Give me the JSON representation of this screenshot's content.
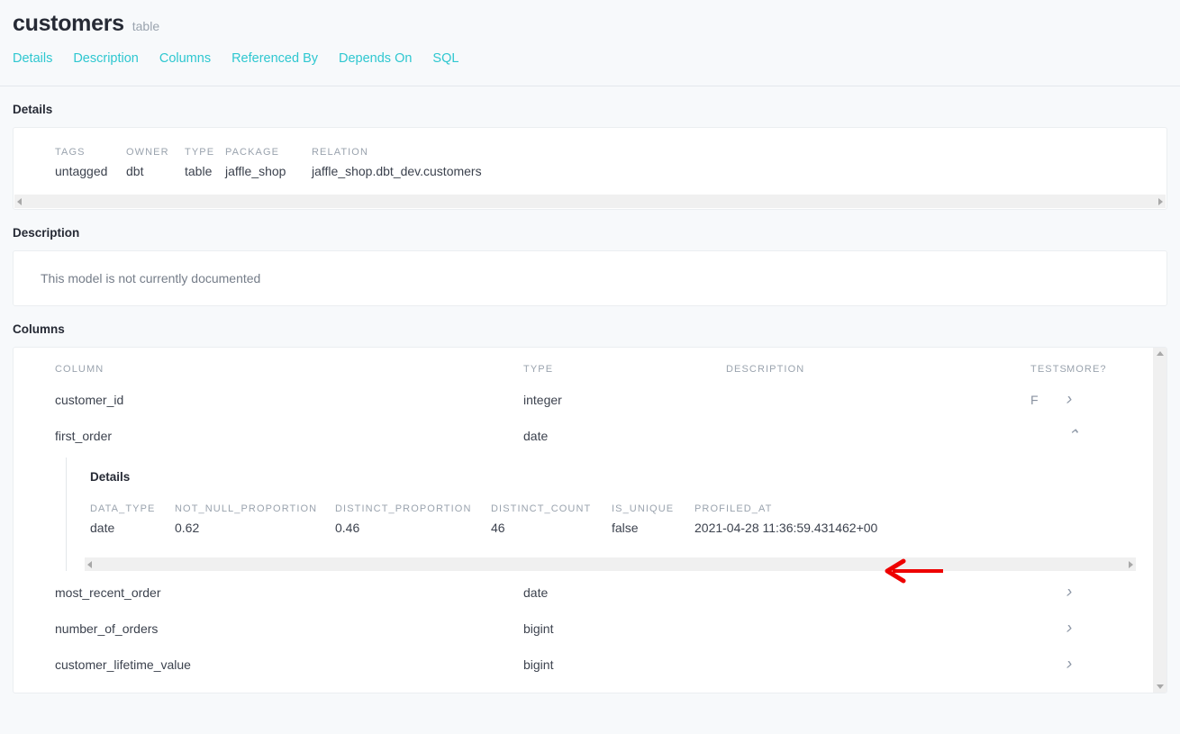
{
  "header": {
    "title": "customers",
    "subtitle": "table",
    "tabs": [
      {
        "label": "Details"
      },
      {
        "label": "Description"
      },
      {
        "label": "Columns"
      },
      {
        "label": "Referenced By"
      },
      {
        "label": "Depends On"
      },
      {
        "label": "SQL"
      }
    ]
  },
  "details": {
    "section_label": "Details",
    "fields": [
      {
        "label": "TAGS",
        "value": "untagged"
      },
      {
        "label": "OWNER",
        "value": "dbt"
      },
      {
        "label": "TYPE",
        "value": "table"
      },
      {
        "label": "PACKAGE",
        "value": "jaffle_shop"
      },
      {
        "label": "RELATION",
        "value": "jaffle_shop.dbt_dev.customers"
      }
    ]
  },
  "description": {
    "section_label": "Description",
    "text": "This model is not currently documented"
  },
  "columns": {
    "section_label": "Columns",
    "headers": {
      "column": "COLUMN",
      "type": "TYPE",
      "description": "DESCRIPTION",
      "tests": "TESTS",
      "more": "MORE?"
    },
    "rows": [
      {
        "column": "customer_id",
        "type": "integer",
        "description": "",
        "tests": "F",
        "more_icon": "chevron-right-icon",
        "expanded": false
      },
      {
        "column": "first_order",
        "type": "date",
        "description": "",
        "tests": "",
        "more_icon": "chevron-up-icon",
        "expanded": true
      },
      {
        "column": "most_recent_order",
        "type": "date",
        "description": "",
        "tests": "",
        "more_icon": "chevron-right-icon",
        "expanded": false
      },
      {
        "column": "number_of_orders",
        "type": "bigint",
        "description": "",
        "tests": "",
        "more_icon": "chevron-right-icon",
        "expanded": false
      },
      {
        "column": "customer_lifetime_value",
        "type": "bigint",
        "description": "",
        "tests": "",
        "more_icon": "chevron-right-icon",
        "expanded": false
      }
    ],
    "expanded_detail": {
      "title": "Details",
      "fields": [
        {
          "label": "DATA_TYPE",
          "value": "date"
        },
        {
          "label": "NOT_NULL_PROPORTION",
          "value": "0.62"
        },
        {
          "label": "DISTINCT_PROPORTION",
          "value": "0.46"
        },
        {
          "label": "DISTINCT_COUNT",
          "value": "46"
        },
        {
          "label": "IS_UNIQUE",
          "value": "false"
        },
        {
          "label": "PROFILED_AT",
          "value": "2021-04-28 11:36:59.431462+00"
        }
      ]
    }
  },
  "annotation": {
    "type": "arrow-left",
    "color": "#ee0000",
    "points_to": "2021-04-28 11:36:59.431462+00"
  },
  "colors": {
    "accent": "#2ec7d0",
    "page_bg": "#f7f9fb",
    "card_bg": "#ffffff",
    "text": "#3c424e",
    "muted": "#9aa3ae",
    "annotation_red": "#ee0000"
  },
  "scrollbars": {
    "details_h": {
      "left_icon": "caret-left-icon",
      "right_icon": "caret-right-icon"
    },
    "expanded_h": {
      "left_icon": "caret-left-icon",
      "right_icon": "caret-right-icon"
    },
    "columns_v": {
      "up_icon": "caret-up-icon",
      "down_icon": "caret-down-icon"
    }
  }
}
